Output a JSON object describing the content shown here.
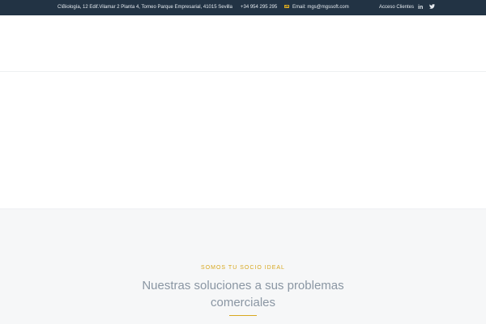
{
  "topbar": {
    "address": "C\\Biología, 12 Edif.Vilamar 2 Planta 4, Torneo Parque Empresarial, 41015 Sevilla",
    "phone": "+34 954 295 295",
    "email": "Email: mgs@mgssoft.com",
    "access": "Acceso Clientes",
    "icons": {
      "mail": "envelope-icon",
      "linkedin": "linkedin-icon",
      "twitter": "twitter-icon"
    },
    "linkedin_glyph": "in",
    "twitter_glyph": "🐦"
  },
  "section": {
    "eyebrow": "SOMOS TU SOCIO IDEAL",
    "heading": "Nuestras soluciones a sus problemas comerciales"
  },
  "colors": {
    "topbar_bg": "#223344",
    "accent": "#d8a820",
    "heading": "#8a96a3",
    "section_bg": "#f6f7f8"
  }
}
